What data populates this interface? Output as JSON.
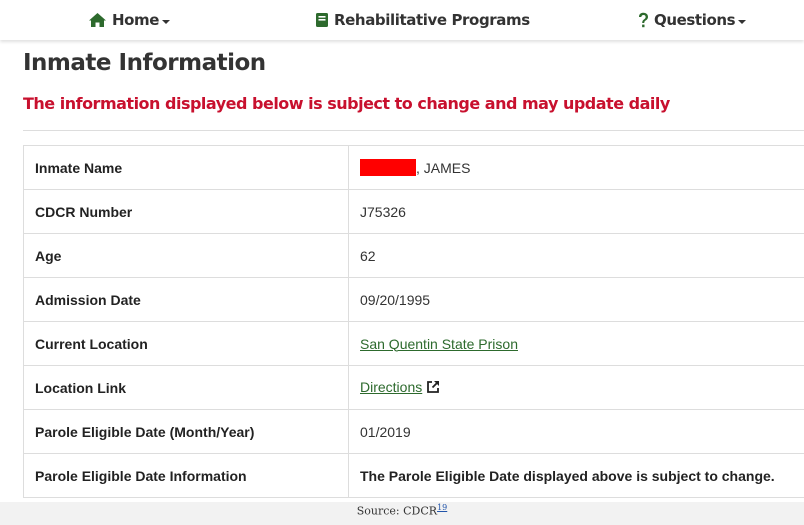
{
  "nav": {
    "home_label": "Home",
    "programs_label": "Rehabilitative Programs",
    "questions_label": "Questions"
  },
  "page": {
    "title": "Inmate Information",
    "notice": "The information displayed below is subject to change and may update daily"
  },
  "rows": {
    "name": {
      "label": "Inmate Name",
      "value": ", JAMES"
    },
    "cdcr": {
      "label": "CDCR Number",
      "value": "J75326"
    },
    "age": {
      "label": "Age",
      "value": "62"
    },
    "admission": {
      "label": "Admission Date",
      "value": "09/20/1995"
    },
    "location": {
      "label": "Current Location",
      "value": "San Quentin State Prison"
    },
    "location_link": {
      "label": "Location Link",
      "value": "Directions"
    },
    "parole_date": {
      "label": "Parole Eligible Date (Month/Year)",
      "value": "01/2019"
    },
    "parole_info": {
      "label": "Parole Eligible Date Information",
      "value": "The Parole Eligible Date displayed above is subject to change."
    }
  },
  "caption": {
    "text": "Source: CDCR",
    "ref": "19"
  },
  "colors": {
    "brand_green": "#2d6a2d",
    "notice_red": "#c8102e",
    "redaction": "#ff0000"
  },
  "icons": {
    "home": "home-icon",
    "programs": "book-icon",
    "questions": "question-icon",
    "external": "external-link-icon"
  }
}
